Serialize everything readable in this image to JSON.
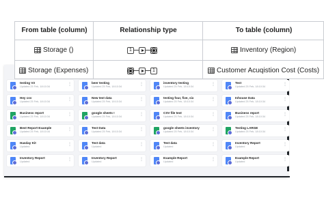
{
  "table": {
    "headers": [
      "From table (column)",
      "Relationship type",
      "To table (column)"
    ],
    "rows": [
      {
        "from": "Storage ()",
        "relationship": "one-to-many",
        "to": "Inventory (Region)",
        "left_label": "1",
        "right_label": ""
      },
      {
        "from": "Storage (Expenses)",
        "relationship": "many-to-one",
        "to": "Customer Acuqistion Cost (Costs)",
        "left_label": "",
        "right_label": "1"
      }
    ]
  },
  "cards": [
    {
      "title": "testing V3",
      "sub": "Updated 25 Feb, 18:10:34",
      "type": "doc"
    },
    {
      "title": "beer testing",
      "sub": "Updated 25 Feb, 18:10:34",
      "type": "doc"
    },
    {
      "title": "inventory testing",
      "sub": "Updated 25 Feb, 18:10:34",
      "type": "doc"
    },
    {
      "title": "Test",
      "sub": "Updated 25 Feb, 18:10:34",
      "type": "doc"
    },
    {
      "title": "Hey csv",
      "sub": "Updated 25 Feb, 18:10:34",
      "type": "doc"
    },
    {
      "title": "New test data",
      "sub": "Updated 25 Feb, 18:10:34",
      "type": "doc"
    },
    {
      "title": "testing four, five, six",
      "sub": "Updated 25 Feb, 18:10:34",
      "type": "doc"
    },
    {
      "title": "Inhouse Data",
      "sub": "Updated 25 Feb, 18:10:34",
      "type": "doc"
    },
    {
      "title": "Business report",
      "sub": "Updated 25 Feb, 18:10:34",
      "type": "sheet"
    },
    {
      "title": "google sheets !",
      "sub": "Updated 25 Feb, 18:10:34",
      "type": "sheet"
    },
    {
      "title": "CSV file test",
      "sub": "Updated 25 Feb, 18:10:34",
      "type": "doc"
    },
    {
      "title": "Business report",
      "sub": "Updated 25 Feb, 18:10:34",
      "type": "doc"
    },
    {
      "title": "Best Report Example",
      "sub": "Updated 25 Feb, 18:10:34",
      "type": "sheet"
    },
    {
      "title": "Test Data",
      "sub": "Updated 25 Feb, 18:10:34",
      "type": "doc"
    },
    {
      "title": "google sheets inventory",
      "sub": "Updated 25 Feb, 18:10:34",
      "type": "sheet"
    },
    {
      "title": "Testing LARGE",
      "sub": "Updated 25 Feb, 18:10:34",
      "type": "sheet"
    },
    {
      "title": "Hasday Kit",
      "sub": "Updated",
      "type": "doc"
    },
    {
      "title": "Test data",
      "sub": "Updated",
      "type": "doc"
    },
    {
      "title": "Test data",
      "sub": "Updated",
      "type": "doc"
    },
    {
      "title": "Inventory Report",
      "sub": "Updated",
      "type": "doc"
    },
    {
      "title": "Inventory Report",
      "sub": "Updated",
      "type": "doc"
    },
    {
      "title": "Inventory Report",
      "sub": "Updated",
      "type": "doc"
    },
    {
      "title": "Example Report",
      "sub": "Updated",
      "type": "doc"
    },
    {
      "title": "Example Report",
      "sub": "Updated",
      "type": "doc"
    }
  ]
}
